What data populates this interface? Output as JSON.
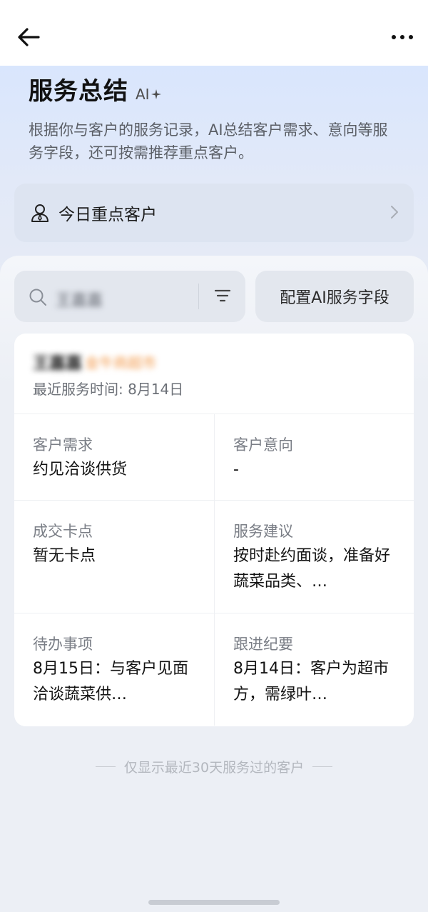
{
  "header": {
    "title": "服务总结",
    "ai_badge": "AI",
    "description": "根据你与客户的服务记录，AI总结客户需求、意向等服务字段，还可按需推荐重点客户。"
  },
  "key_customers": {
    "label": "今日重点客户"
  },
  "search": {
    "value": "王嘉嘉"
  },
  "config_button": {
    "label": "配置AI服务字段"
  },
  "customer": {
    "name": "王嘉嘉",
    "tag": "金牛商超市",
    "last_service": "最近服务时间: 8月14日",
    "fields": [
      {
        "key": "客户需求",
        "value": "约见洽谈供货"
      },
      {
        "key": "客户意向",
        "value": "-"
      },
      {
        "key": "成交卡点",
        "value": "暂无卡点"
      },
      {
        "key": "服务建议",
        "value": "按时赴约面谈，准备好蔬菜品类、…"
      },
      {
        "key": "待办事项",
        "value": "8月15日：与客户见面洽谈蔬菜供…"
      },
      {
        "key": "跟进纪要",
        "value": "8月14日：客户为超市方，需绿叶…"
      }
    ]
  },
  "footnote": "仅显示最近30天服务过的客户",
  "colors": {
    "accent_orange": "#f2994a",
    "hero_blue": "#d9e6fd",
    "background": "#eceff5"
  }
}
